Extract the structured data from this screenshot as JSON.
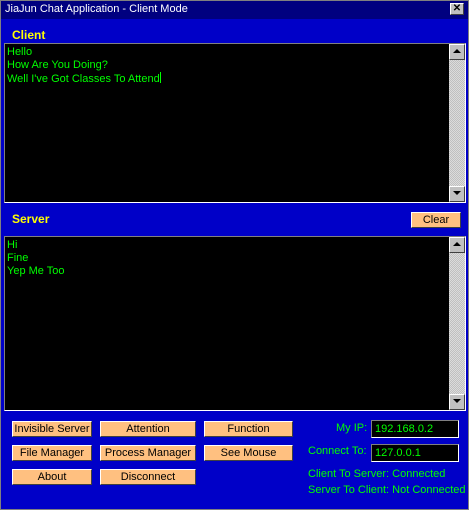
{
  "window": {
    "title": "JiaJun Chat Application - Client Mode",
    "close_label": "✕"
  },
  "client": {
    "label": "Client",
    "lines": [
      "Hello",
      "How Are You Doing?",
      "Well I've Got Classes To Attend"
    ]
  },
  "server": {
    "label": "Server",
    "clear_label": "Clear",
    "lines": [
      "Hi",
      "Fine",
      "Yep Me Too"
    ]
  },
  "buttons": {
    "invisible_server": "Invisible Server",
    "attention": "Attention",
    "function": "Function",
    "file_manager": "File Manager",
    "process_manager": "Process Manager",
    "see_mouse": "See Mouse",
    "about": "About",
    "disconnect": "Disconnect"
  },
  "connection": {
    "my_ip_label": "My IP:",
    "my_ip_value": "192.168.0.2",
    "connect_to_label": "Connect To:",
    "connect_to_value": "127.0.0.1",
    "client_to_server": "Client To Server: Connected",
    "server_to_client": "Server To Client: Not Connected"
  },
  "colors": {
    "background": "#0000c8",
    "text": "#00ff00",
    "label": "#ffff00",
    "button": "#ffc080"
  }
}
